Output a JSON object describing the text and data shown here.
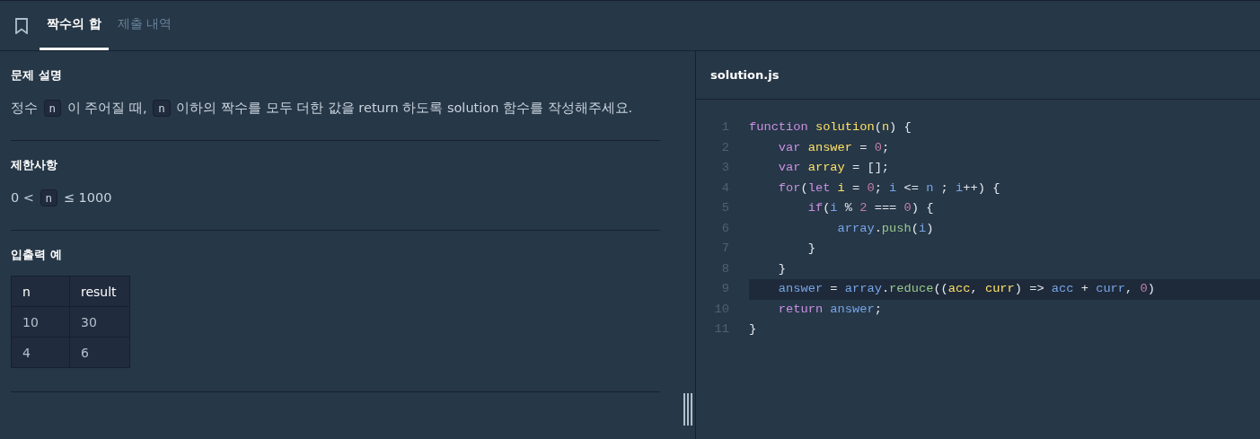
{
  "tabs": [
    {
      "label": "짝수의 합",
      "selected": true
    },
    {
      "label": "제출 내역",
      "selected": false
    }
  ],
  "sections": [
    {
      "kind": "text",
      "heading": "문제 설명",
      "segments": [
        {
          "kind": "text",
          "text": "정수 "
        },
        {
          "kind": "code",
          "text": "n"
        },
        {
          "kind": "text",
          "text": " 이 주어질 때, "
        },
        {
          "kind": "code",
          "text": "n"
        },
        {
          "kind": "text",
          "text": " 이하의 짝수를 모두 더한 값을 return 하도록 solution 함수를 작성해주세요."
        }
      ]
    },
    {
      "kind": "text",
      "heading": "제한사항",
      "segments": [
        {
          "kind": "text",
          "text": "0 < "
        },
        {
          "kind": "code",
          "text": "n"
        },
        {
          "kind": "text",
          "text": " ≤ 1000"
        }
      ]
    },
    {
      "kind": "table",
      "heading": "입출력 예",
      "columns": [
        "n",
        "result"
      ],
      "rows": [
        [
          "10",
          "30"
        ],
        [
          "4",
          "6"
        ]
      ]
    }
  ],
  "editor": {
    "filename": "solution.js",
    "lines": [
      {
        "number": "1",
        "highlighted": false,
        "tokens": [
          {
            "kind": "keyword",
            "text": "function "
          },
          {
            "kind": "name",
            "text": "solution"
          },
          {
            "kind": "punctuation",
            "text": "("
          },
          {
            "kind": "name",
            "text": "n"
          },
          {
            "kind": "punctuation",
            "text": ") {"
          }
        ]
      },
      {
        "number": "2",
        "highlighted": false,
        "tokens": [
          {
            "kind": "keyword",
            "text": "    var "
          },
          {
            "kind": "name",
            "text": "answer"
          },
          {
            "kind": "punctuation",
            "text": " = "
          },
          {
            "kind": "number",
            "text": "0"
          },
          {
            "kind": "punctuation",
            "text": ";"
          }
        ]
      },
      {
        "number": "3",
        "highlighted": false,
        "tokens": [
          {
            "kind": "keyword",
            "text": "    var "
          },
          {
            "kind": "name",
            "text": "array"
          },
          {
            "kind": "punctuation",
            "text": " = [];"
          }
        ]
      },
      {
        "number": "4",
        "highlighted": false,
        "tokens": [
          {
            "kind": "keyword",
            "text": "    for"
          },
          {
            "kind": "punctuation",
            "text": "("
          },
          {
            "kind": "keyword",
            "text": "let "
          },
          {
            "kind": "name",
            "text": "i"
          },
          {
            "kind": "punctuation",
            "text": " = "
          },
          {
            "kind": "number",
            "text": "0"
          },
          {
            "kind": "punctuation",
            "text": "; "
          },
          {
            "kind": "identifier",
            "text": "i"
          },
          {
            "kind": "punctuation",
            "text": " <= "
          },
          {
            "kind": "identifier",
            "text": "n"
          },
          {
            "kind": "punctuation",
            "text": " ; "
          },
          {
            "kind": "identifier",
            "text": "i"
          },
          {
            "kind": "punctuation",
            "text": "++) {"
          }
        ]
      },
      {
        "number": "5",
        "highlighted": false,
        "tokens": [
          {
            "kind": "keyword",
            "text": "        if"
          },
          {
            "kind": "punctuation",
            "text": "("
          },
          {
            "kind": "identifier",
            "text": "i"
          },
          {
            "kind": "punctuation",
            "text": " % "
          },
          {
            "kind": "number",
            "text": "2"
          },
          {
            "kind": "punctuation",
            "text": " === "
          },
          {
            "kind": "number",
            "text": "0"
          },
          {
            "kind": "punctuation",
            "text": ") {"
          }
        ]
      },
      {
        "number": "6",
        "highlighted": false,
        "tokens": [
          {
            "kind": "identifier",
            "text": "            array"
          },
          {
            "kind": "punctuation",
            "text": "."
          },
          {
            "kind": "method",
            "text": "push"
          },
          {
            "kind": "punctuation",
            "text": "("
          },
          {
            "kind": "identifier",
            "text": "i"
          },
          {
            "kind": "punctuation",
            "text": ")"
          }
        ]
      },
      {
        "number": "7",
        "highlighted": false,
        "tokens": [
          {
            "kind": "punctuation",
            "text": "        }"
          }
        ]
      },
      {
        "number": "8",
        "highlighted": false,
        "tokens": [
          {
            "kind": "punctuation",
            "text": "    }"
          }
        ]
      },
      {
        "number": "9",
        "highlighted": true,
        "tokens": [
          {
            "kind": "identifier",
            "text": "    answer"
          },
          {
            "kind": "punctuation",
            "text": " = "
          },
          {
            "kind": "identifier",
            "text": "array"
          },
          {
            "kind": "punctuation",
            "text": "."
          },
          {
            "kind": "method",
            "text": "reduce"
          },
          {
            "kind": "punctuation",
            "text": "(("
          },
          {
            "kind": "name",
            "text": "acc"
          },
          {
            "kind": "punctuation",
            "text": ", "
          },
          {
            "kind": "name",
            "text": "curr"
          },
          {
            "kind": "punctuation",
            "text": ") => "
          },
          {
            "kind": "identifier",
            "text": "acc"
          },
          {
            "kind": "punctuation",
            "text": " + "
          },
          {
            "kind": "identifier",
            "text": "curr"
          },
          {
            "kind": "punctuation",
            "text": ", "
          },
          {
            "kind": "number",
            "text": "0"
          },
          {
            "kind": "punctuation",
            "text": ")"
          }
        ]
      },
      {
        "number": "10",
        "highlighted": false,
        "tokens": [
          {
            "kind": "keyword",
            "text": "    return "
          },
          {
            "kind": "identifier",
            "text": "answer"
          },
          {
            "kind": "punctuation",
            "text": ";"
          }
        ]
      },
      {
        "number": "11",
        "highlighted": false,
        "tokens": [
          {
            "kind": "punctuation",
            "text": "}"
          }
        ]
      }
    ]
  }
}
